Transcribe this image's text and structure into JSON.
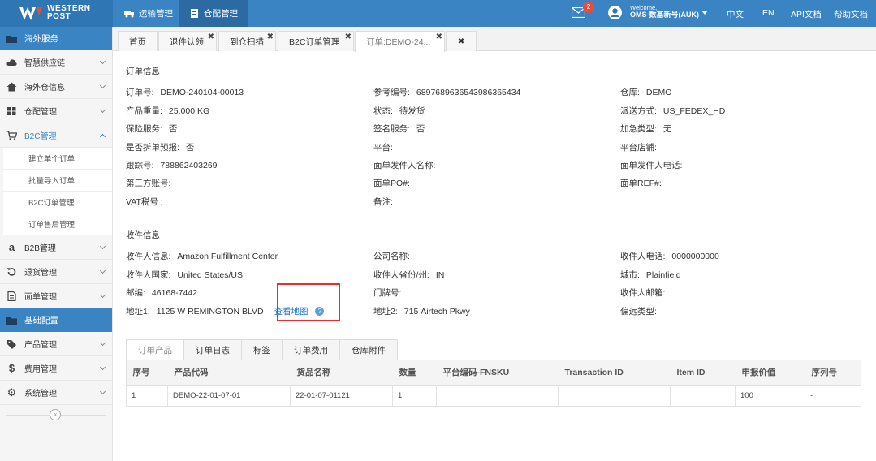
{
  "brand": {
    "line1": "WESTERN",
    "line2": "POST"
  },
  "topnav": [
    {
      "label": "运输管理",
      "active": false
    },
    {
      "label": "仓配管理",
      "active": true
    }
  ],
  "header": {
    "mail_badge": "2",
    "welcome": "Welcome,",
    "user": "OMS-数基新号(AUK)",
    "lang_cn": "中文",
    "lang_en": "EN",
    "api_doc": "API文档",
    "help_doc": "帮助文档"
  },
  "sidebar": {
    "section1": "海外服务",
    "items": [
      {
        "label": "智慧供应链",
        "icon": "cloud-icon"
      },
      {
        "label": "海外仓信息",
        "icon": "home-icon"
      },
      {
        "label": "仓配管理",
        "icon": "grid-icon"
      },
      {
        "label": "B2C管理",
        "icon": "cart-icon"
      }
    ],
    "b2c_sub": [
      "建立单个订单",
      "批量导入订单",
      "B2C订单管理",
      "订单售后管理"
    ],
    "items2": [
      {
        "label": "B2B管理",
        "icon": "amazon-icon"
      },
      {
        "label": "退货管理",
        "icon": "return-icon"
      },
      {
        "label": "面单管理",
        "icon": "document-icon"
      }
    ],
    "section2": "基础配置",
    "items3": [
      {
        "label": "产品管理",
        "icon": "tag-icon"
      },
      {
        "label": "费用管理",
        "icon": "dollar-icon"
      },
      {
        "label": "系统管理",
        "icon": "gear-icon"
      }
    ],
    "collapse": "«"
  },
  "tabs": [
    "首页",
    "退件认领",
    "到仓扫描",
    "B2C订单管理",
    "订单:DEMO-24..."
  ],
  "order_info": {
    "title": "订单信息",
    "fields": [
      {
        "label": "订单号:",
        "value": "DEMO-240104-00013"
      },
      {
        "label": "参考编号:",
        "value": "6897689636543986365434"
      },
      {
        "label": "仓库:",
        "value": "DEMO"
      },
      {
        "label": "产品重量:",
        "value": "25.000 KG"
      },
      {
        "label": "状态:",
        "value": "待发货"
      },
      {
        "label": "派送方式:",
        "value": "US_FEDEX_HD"
      },
      {
        "label": "保险服务:",
        "value": "否"
      },
      {
        "label": "签名服务:",
        "value": "否"
      },
      {
        "label": "加急类型:",
        "value": "无"
      },
      {
        "label": "是否拆单预报:",
        "value": "否"
      },
      {
        "label": "平台:",
        "value": ""
      },
      {
        "label": "平台店铺:",
        "value": ""
      },
      {
        "label": "跟踪号:",
        "value": "788862403269"
      },
      {
        "label": "面单发件人名称:",
        "value": ""
      },
      {
        "label": "面单发件人电话:",
        "value": ""
      },
      {
        "label": "第三方账号:",
        "value": ""
      },
      {
        "label": "面单PO#:",
        "value": ""
      },
      {
        "label": "面单REF#:",
        "value": ""
      },
      {
        "label": "VAT税号 :",
        "value": ""
      },
      {
        "label": "备注:",
        "value": ""
      }
    ]
  },
  "receiver_info": {
    "title": "收件信息",
    "fields": [
      {
        "label": "收件人信息:",
        "value": "Amazon Fulfillment Center"
      },
      {
        "label": "公司名称:",
        "value": ""
      },
      {
        "label": "收件人电话:",
        "value": "0000000000"
      },
      {
        "label": "收件人国家:",
        "value": "United States/US"
      },
      {
        "label": "收件人省份/州:",
        "value": "IN"
      },
      {
        "label": "城市:",
        "value": "Plainfield"
      },
      {
        "label": "邮编:",
        "value": "46168-7442"
      },
      {
        "label": "门牌号:",
        "value": ""
      },
      {
        "label": "收件人邮箱:",
        "value": ""
      },
      {
        "label": "地址1:",
        "value": "1125 W REMINGTON BLVD"
      },
      {
        "label": "地址2:",
        "value": "715 Airtech Pkwy"
      },
      {
        "label": "偏远类型:",
        "value": ""
      }
    ],
    "map_link": "查看地图",
    "help": "?"
  },
  "subtabs": [
    "订单产品",
    "订单日志",
    "标签",
    "订单费用",
    "仓库附件"
  ],
  "table": {
    "headers": [
      "序号",
      "产品代码",
      "货品名称",
      "数量",
      "平台编码-FNSKU",
      "Transaction ID",
      "Item ID",
      "申报价值",
      "序列号"
    ],
    "rows": [
      [
        "1",
        "DEMO-22-01-07-01",
        "22-01-07-01121",
        "1",
        "",
        "",
        "",
        "100",
        "-"
      ]
    ]
  }
}
